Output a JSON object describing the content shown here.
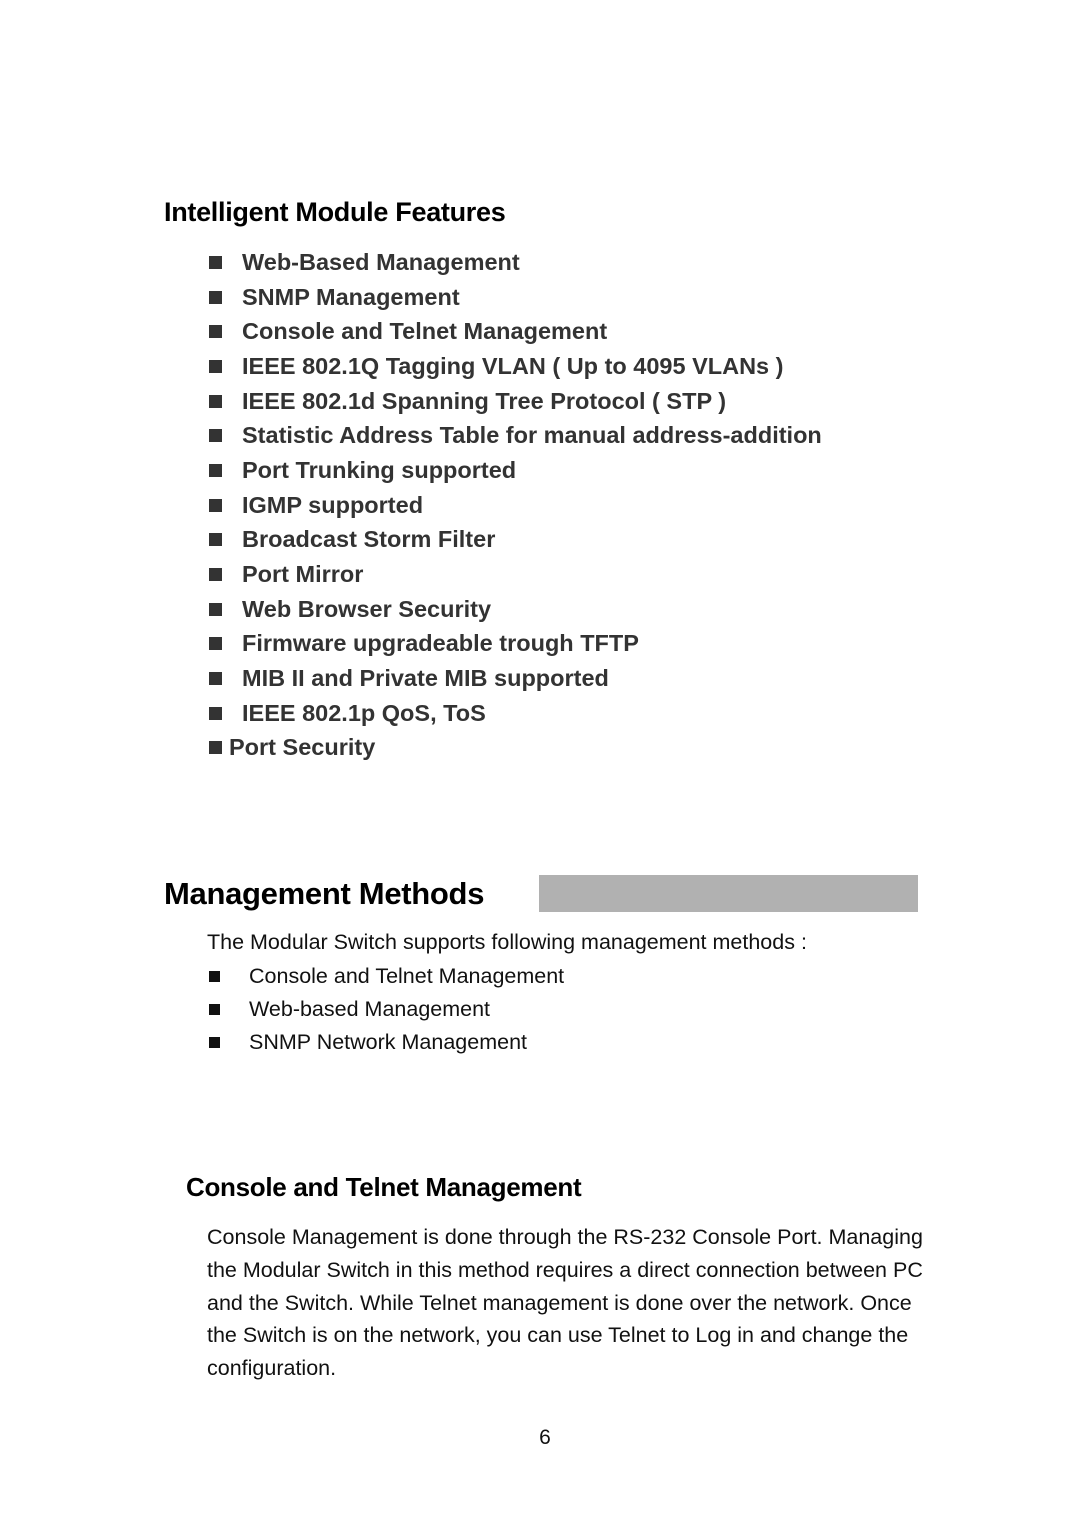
{
  "features": {
    "heading": "Intelligent Module Features",
    "items": [
      "Web-Based Management",
      "SNMP Management",
      "Console and Telnet Management",
      "IEEE 802.1Q Tagging VLAN ( Up to 4095 VLANs )",
      "IEEE 802.1d Spanning Tree Protocol ( STP )",
      "Statistic Address Table for manual address-addition",
      "Port Trunking supported",
      "IGMP supported",
      "Broadcast Storm Filter",
      "Port Mirror",
      "Web Browser Security",
      "Firmware upgradeable trough TFTP",
      "MIB II and Private MIB supported",
      "IEEE 802.1p QoS, ToS",
      "Port Security"
    ],
    "bullet_icon": "black-square"
  },
  "management": {
    "heading": "Management Methods",
    "intro": "The Modular Switch supports following management methods :",
    "items": [
      "Console and Telnet Management",
      "Web-based Management",
      "SNMP Network Management"
    ]
  },
  "console": {
    "heading": "Console and Telnet Management",
    "paragraph": "Console Management is done through the RS-232 Console Port. Managing the Modular Switch in this method requires a direct connection between PC and the Switch. While Telnet management is done over the network. Once the Switch is on the network, you can use Telnet to Log in and change the configuration."
  },
  "footer": {
    "page_number": "6"
  }
}
